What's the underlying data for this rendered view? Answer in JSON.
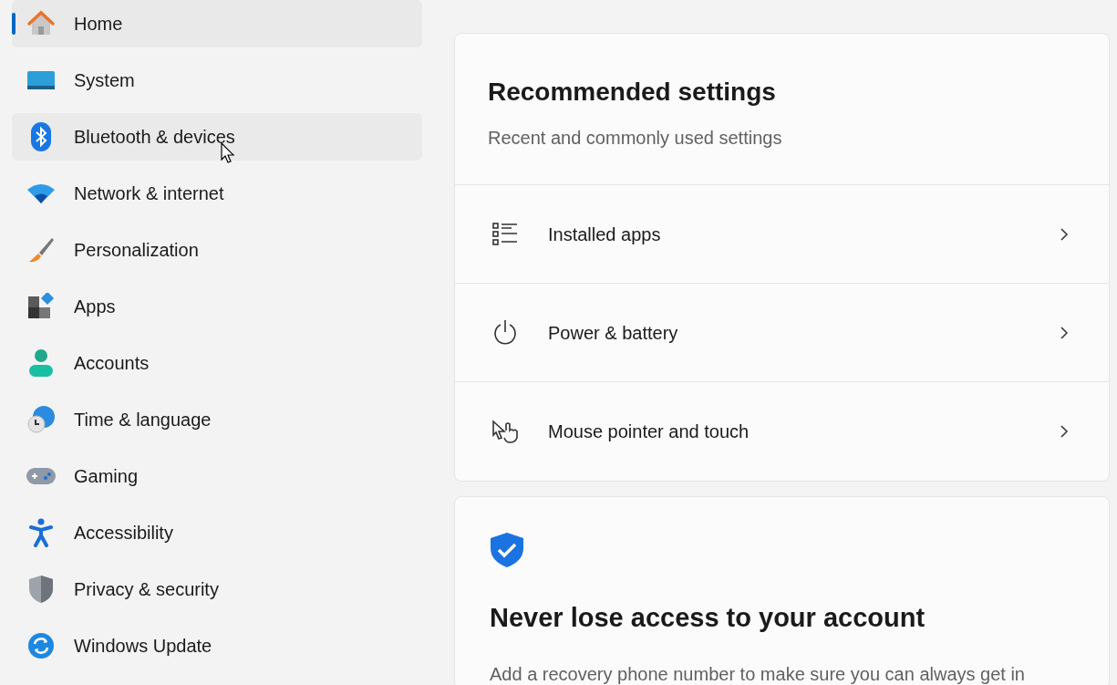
{
  "sidebar": {
    "items": [
      {
        "label": "Home",
        "selected": true,
        "hovered": false
      },
      {
        "label": "System",
        "selected": false,
        "hovered": false
      },
      {
        "label": "Bluetooth & devices",
        "selected": false,
        "hovered": true
      },
      {
        "label": "Network & internet",
        "selected": false,
        "hovered": false
      },
      {
        "label": "Personalization",
        "selected": false,
        "hovered": false
      },
      {
        "label": "Apps",
        "selected": false,
        "hovered": false
      },
      {
        "label": "Accounts",
        "selected": false,
        "hovered": false
      },
      {
        "label": "Time & language",
        "selected": false,
        "hovered": false
      },
      {
        "label": "Gaming",
        "selected": false,
        "hovered": false
      },
      {
        "label": "Accessibility",
        "selected": false,
        "hovered": false
      },
      {
        "label": "Privacy & security",
        "selected": false,
        "hovered": false
      },
      {
        "label": "Windows Update",
        "selected": false,
        "hovered": false
      }
    ]
  },
  "recommended": {
    "title": "Recommended settings",
    "subtitle": "Recent and commonly used settings",
    "rows": [
      {
        "label": "Installed apps"
      },
      {
        "label": "Power & battery"
      },
      {
        "label": "Mouse pointer and touch"
      }
    ]
  },
  "account_card": {
    "title": "Never lose access to your account",
    "body": "Add a recovery phone number to make sure you can always get in"
  }
}
